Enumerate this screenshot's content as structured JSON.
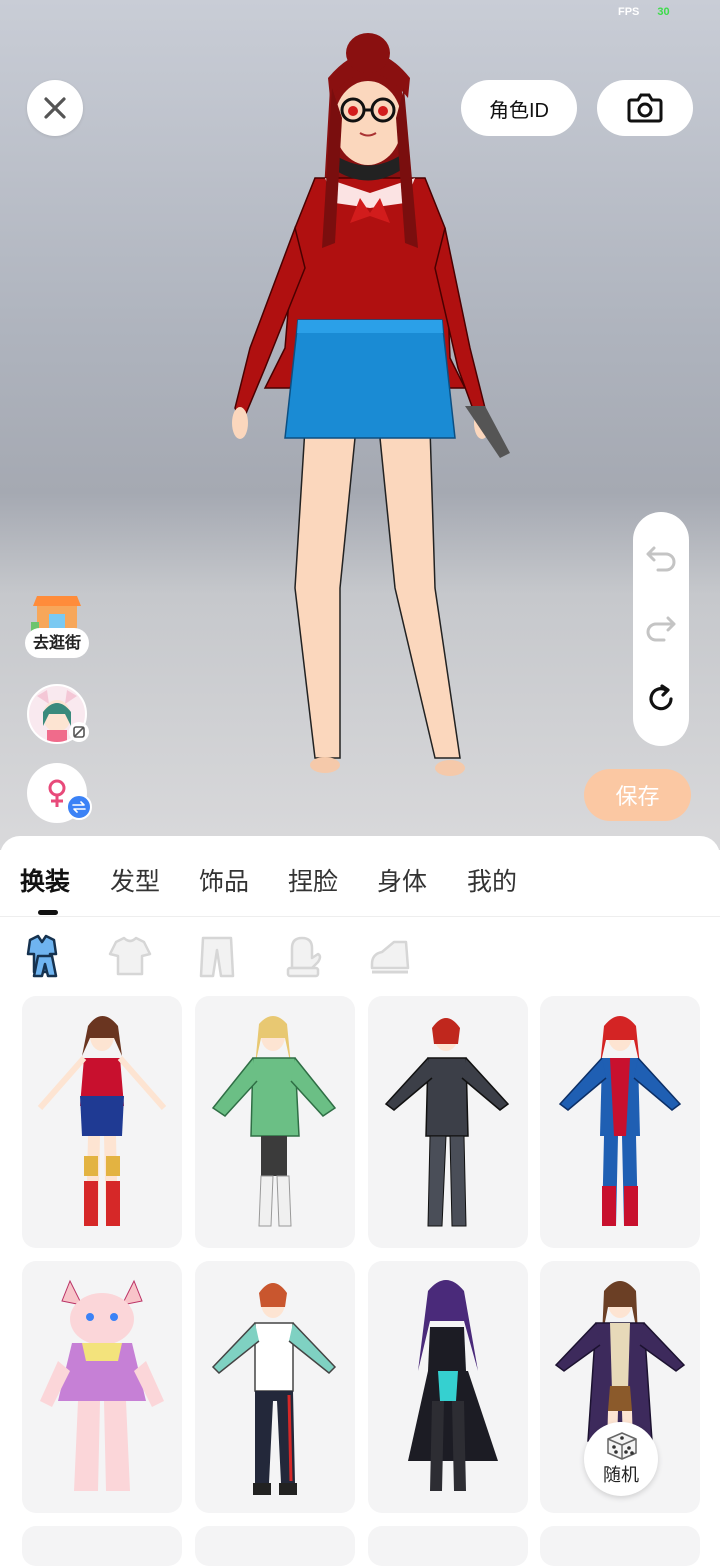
{
  "status": {
    "fps_label": "FPS",
    "fps_value": "30"
  },
  "topbar": {
    "role_id_label": "角色ID"
  },
  "side": {
    "shop_label": "去逛街"
  },
  "actions": {
    "save_label": "保存"
  },
  "tabs": [
    {
      "label": "换装"
    },
    {
      "label": "发型"
    },
    {
      "label": "饰品"
    },
    {
      "label": "捏脸"
    },
    {
      "label": "身体"
    },
    {
      "label": "我的"
    }
  ],
  "subcategories": [
    "full-outfit-icon",
    "top-icon",
    "pants-icon",
    "gloves-icon",
    "shoes-icon"
  ],
  "outfits": [
    {
      "name": "wonder-outfit"
    },
    {
      "name": "green-kimono-outfit"
    },
    {
      "name": "black-suit-outfit"
    },
    {
      "name": "captain-outfit"
    },
    {
      "name": "pink-cat-outfit"
    },
    {
      "name": "tracksuit-outfit"
    },
    {
      "name": "gothic-dress-outfit"
    },
    {
      "name": "academy-robe-outfit"
    }
  ],
  "random": {
    "label": "随机"
  },
  "colors": {
    "accent_save": "#fbc8a3",
    "gender_badge": "#3b82f6",
    "female_symbol": "#e84a7a"
  }
}
